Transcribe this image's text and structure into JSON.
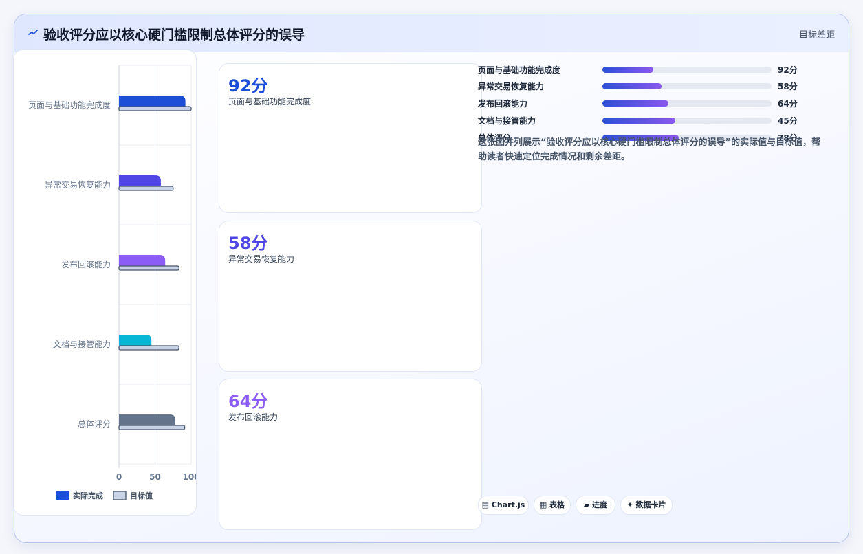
{
  "header": {
    "title": "验收评分应以核心硬门槛限制总体评分的误导",
    "tag": "目标差距",
    "icon": "trend-line-icon"
  },
  "colors": {
    "accent": "#1d4ed8",
    "card_values": [
      "#1d4ed8",
      "#4f46e5",
      "#8b5cf6"
    ],
    "bar_colors": [
      "#1d4ed8",
      "#4f46e5",
      "#8b5cf6",
      "#06b6d4",
      "#64748b"
    ],
    "target_fill": "#c8d4e6",
    "target_stroke": "#475569"
  },
  "cards": [
    {
      "value": "92分",
      "label": "页面与基础功能完成度"
    },
    {
      "value": "58分",
      "label": "异常交易恢复能力"
    },
    {
      "value": "64分",
      "label": "发布回滚能力"
    }
  ],
  "progress": [
    {
      "label": "页面与基础功能完成度",
      "value_text": "92分",
      "percent": 30
    },
    {
      "label": "异常交易恢复能力",
      "value_text": "58分",
      "percent": 35
    },
    {
      "label": "发布回滚能力",
      "value_text": "64分",
      "percent": 39
    },
    {
      "label": "文档与接管能力",
      "value_text": "45分",
      "percent": 43
    },
    {
      "label": "总体评分",
      "value_text": "78分",
      "percent": 45
    }
  ],
  "description": "这张图并列展示“验收评分应以核心硬门槛限制总体评分的误导”的实际值与目标值，帮助读者快速定位完成情况和剩余差距。",
  "chips": [
    {
      "label": "▤ Chart.js"
    },
    {
      "label": "▦ 表格"
    },
    {
      "label": "▰ 进度"
    },
    {
      "label": "✦ 数据卡片"
    }
  ],
  "chart_data": {
    "type": "bar",
    "orientation": "horizontal",
    "categories": [
      "页面与基础功能完成度",
      "异常交易恢复能力",
      "发布回滚能力",
      "文档与接管能力",
      "总体评分"
    ],
    "series": [
      {
        "name": "实际完成",
        "values": [
          92,
          58,
          64,
          45,
          78
        ]
      },
      {
        "name": "目标值",
        "values": [
          100,
          75,
          83,
          83,
          91
        ]
      }
    ],
    "xlim": [
      0,
      100
    ],
    "xticks": [
      "0",
      "50",
      "100"
    ],
    "grid": true,
    "legend": "bottom"
  }
}
